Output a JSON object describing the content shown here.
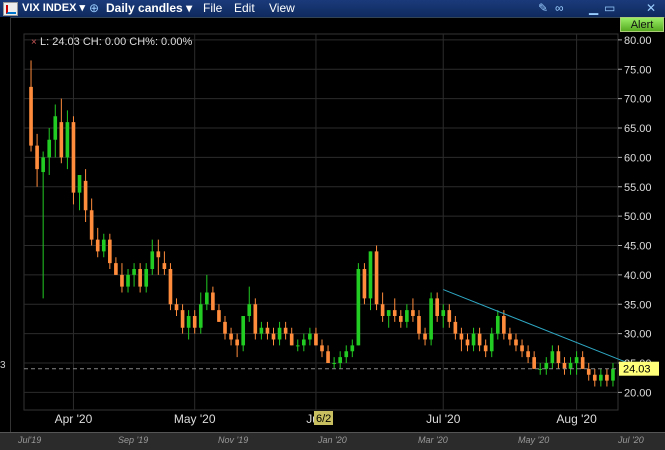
{
  "window": {
    "symbol": "VIX INDEX",
    "interval": "Daily candles",
    "menus": [
      "File",
      "Edit",
      "View"
    ],
    "alert_label": "Alert"
  },
  "colors": {
    "up": "#22cc22",
    "down": "#ff8c3c",
    "background": "#000000",
    "grid": "#2c2c2c",
    "trendline": "#2fa8c4",
    "price_tag": "#ffff7a"
  },
  "info_line": "L: 24.03 CH: 0.00 CH%: 0.00%",
  "last_price_label": "24.03",
  "crosshair_date_label": "6/2",
  "left_edge_fragment": "3",
  "chart_data": {
    "type": "candlestick",
    "ylim": [
      17,
      81
    ],
    "y_ticks": [
      "80.00",
      "75.00",
      "70.00",
      "65.00",
      "60.00",
      "55.00",
      "50.00",
      "45.00",
      "40.00",
      "35.00",
      "30.00",
      "25.00",
      "20.00"
    ],
    "x_tick_labels": [
      "Apr '20",
      "May '20",
      "Jun",
      "Jul '20",
      "Aug '20"
    ],
    "x_tick_index": [
      7,
      27,
      47,
      68,
      90
    ],
    "candles": [
      [
        72.0,
        76.5,
        61.0,
        62.0
      ],
      [
        62.0,
        64.0,
        55.0,
        58.0
      ],
      [
        57.5,
        61.0,
        36.0,
        60.0
      ],
      [
        60.0,
        65.0,
        57.0,
        63.0
      ],
      [
        63.0,
        69.0,
        60.0,
        67.0
      ],
      [
        66.0,
        70.0,
        59.0,
        60.0
      ],
      [
        60.0,
        68.0,
        58.0,
        66.0
      ],
      [
        66.0,
        67.0,
        52.0,
        54.0
      ],
      [
        54.0,
        57.0,
        51.0,
        57.0
      ],
      [
        56.0,
        58.0,
        49.0,
        51.0
      ],
      [
        51.0,
        53.0,
        45.0,
        46.0
      ],
      [
        46.0,
        48.0,
        43.0,
        44.0
      ],
      [
        44.0,
        47.0,
        43.0,
        46.0
      ],
      [
        46.0,
        47.0,
        41.0,
        42.0
      ],
      [
        42.0,
        43.0,
        40.0,
        40.0
      ],
      [
        40.0,
        42.0,
        37.0,
        38.0
      ],
      [
        38.0,
        41.0,
        37.0,
        40.0
      ],
      [
        40.0,
        42.0,
        38.0,
        41.0
      ],
      [
        41.0,
        42.0,
        37.0,
        38.0
      ],
      [
        38.0,
        42.0,
        37.0,
        41.0
      ],
      [
        41.0,
        46.0,
        40.0,
        44.0
      ],
      [
        44.0,
        46.0,
        40.0,
        43.0
      ],
      [
        42.0,
        44.0,
        40.0,
        41.0
      ],
      [
        41.0,
        42.0,
        34.0,
        35.0
      ],
      [
        35.0,
        36.0,
        33.0,
        34.0
      ],
      [
        34.0,
        35.0,
        30.0,
        31.0
      ],
      [
        31.0,
        34.0,
        29.0,
        33.0
      ],
      [
        33.0,
        34.0,
        30.0,
        31.0
      ],
      [
        31.0,
        37.0,
        30.0,
        35.0
      ],
      [
        35.0,
        40.0,
        34.0,
        37.0
      ],
      [
        37.0,
        38.0,
        34.0,
        34.0
      ],
      [
        34.0,
        35.0,
        32.0,
        32.0
      ],
      [
        32.0,
        33.0,
        29.0,
        30.0
      ],
      [
        30.0,
        31.0,
        28.0,
        29.0
      ],
      [
        29.0,
        30.0,
        26.0,
        28.0
      ],
      [
        28.0,
        33.0,
        27.0,
        33.0
      ],
      [
        33.0,
        38.0,
        32.0,
        35.0
      ],
      [
        35.0,
        36.0,
        29.0,
        30.0
      ],
      [
        30.0,
        32.0,
        29.0,
        31.0
      ],
      [
        31.0,
        32.0,
        29.0,
        30.0
      ],
      [
        30.0,
        31.0,
        28.0,
        29.0
      ],
      [
        29.0,
        32.0,
        28.0,
        31.0
      ],
      [
        31.0,
        32.0,
        29.0,
        30.0
      ],
      [
        30.0,
        31.0,
        28.0,
        28.0
      ],
      [
        28.0,
        29.0,
        27.0,
        28.0
      ],
      [
        28.0,
        30.0,
        27.0,
        29.0
      ],
      [
        29.0,
        31.0,
        28.0,
        30.0
      ],
      [
        30.0,
        31.0,
        28.0,
        28.0
      ],
      [
        28.0,
        29.0,
        26.0,
        27.0
      ],
      [
        27.0,
        28.0,
        25.0,
        25.0
      ],
      [
        25.0,
        26.0,
        24.0,
        25.0
      ],
      [
        25.0,
        27.0,
        24.0,
        26.0
      ],
      [
        26.0,
        28.0,
        25.0,
        27.0
      ],
      [
        27.0,
        29.0,
        26.0,
        28.0
      ],
      [
        28.0,
        42.0,
        28.0,
        41.0
      ],
      [
        41.0,
        42.0,
        35.0,
        36.0
      ],
      [
        36.0,
        44.0,
        34.0,
        44.0
      ],
      [
        44.0,
        45.0,
        34.0,
        35.0
      ],
      [
        35.0,
        37.0,
        32.0,
        33.0
      ],
      [
        33.0,
        34.0,
        31.0,
        34.0
      ],
      [
        34.0,
        36.0,
        32.0,
        33.0
      ],
      [
        33.0,
        34.0,
        31.0,
        32.0
      ],
      [
        32.0,
        35.0,
        31.0,
        34.0
      ],
      [
        34.0,
        36.0,
        32.0,
        33.0
      ],
      [
        33.0,
        34.0,
        29.0,
        30.0
      ],
      [
        30.0,
        31.0,
        28.0,
        29.0
      ],
      [
        29.0,
        37.0,
        28.0,
        36.0
      ],
      [
        36.0,
        37.0,
        32.0,
        33.0
      ],
      [
        33.0,
        35.0,
        31.0,
        34.0
      ],
      [
        34.0,
        35.0,
        31.0,
        32.0
      ],
      [
        32.0,
        33.0,
        29.0,
        30.0
      ],
      [
        30.0,
        31.0,
        27.0,
        29.0
      ],
      [
        29.0,
        30.0,
        27.0,
        28.0
      ],
      [
        28.0,
        31.0,
        27.0,
        30.0
      ],
      [
        30.0,
        31.0,
        27.0,
        28.0
      ],
      [
        28.0,
        29.0,
        26.0,
        27.0
      ],
      [
        27.0,
        31.0,
        26.0,
        30.0
      ],
      [
        30.0,
        34.0,
        29.0,
        33.0
      ],
      [
        33.0,
        34.0,
        29.0,
        30.0
      ],
      [
        30.0,
        31.0,
        28.0,
        29.0
      ],
      [
        29.0,
        30.0,
        27.0,
        28.0
      ],
      [
        28.0,
        29.0,
        26.0,
        27.0
      ],
      [
        27.0,
        28.0,
        25.0,
        26.0
      ],
      [
        26.0,
        27.0,
        24.0,
        24.0
      ],
      [
        24.0,
        25.0,
        23.0,
        24.0
      ],
      [
        24.0,
        26.0,
        23.0,
        25.0
      ],
      [
        25.0,
        28.0,
        24.0,
        27.0
      ],
      [
        27.0,
        28.0,
        24.0,
        25.0
      ],
      [
        25.0,
        26.0,
        23.0,
        24.0
      ],
      [
        24.0,
        26.0,
        23.0,
        25.0
      ],
      [
        25.0,
        27.0,
        23.0,
        26.0
      ],
      [
        26.0,
        27.0,
        24.0,
        24.0
      ],
      [
        24.0,
        25.0,
        22.0,
        23.0
      ],
      [
        23.0,
        24.0,
        21.0,
        22.0
      ],
      [
        22.0,
        24.0,
        21.0,
        23.0
      ],
      [
        23.0,
        24.0,
        21.0,
        22.0
      ],
      [
        22.0,
        25.0,
        21.0,
        24.03
      ]
    ],
    "trendline": {
      "from_index": 68,
      "from_value": 37.5,
      "to_index": 99,
      "to_value": 24.8
    },
    "overview_labels": [
      "Jul'19",
      "Sep '19",
      "Nov '19",
      "Jan '20",
      "Mar '20",
      "May '20",
      "Jul '20"
    ]
  }
}
